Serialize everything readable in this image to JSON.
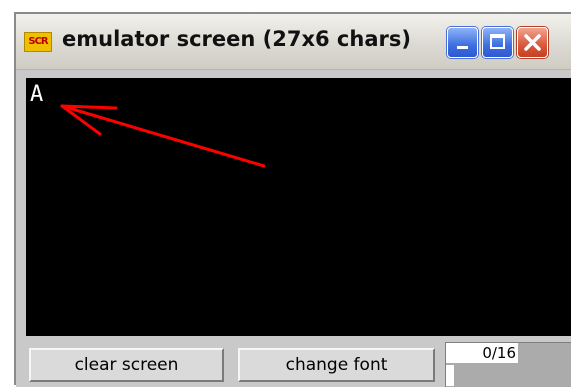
{
  "window": {
    "title": "emulator screen (27x6 chars)",
    "app_icon_text": "SCR",
    "icon": "scr-app-icon"
  },
  "title_buttons": {
    "minimize_icon": "minimize-icon",
    "maximize_icon": "maximize-icon",
    "close_icon": "close-icon"
  },
  "screen": {
    "text": "A",
    "background": "#000000",
    "foreground": "#ffffff",
    "annotation_color": "#ff0000"
  },
  "toolbar": {
    "clear_label": "clear screen",
    "font_label": "change font"
  },
  "progress": {
    "label": "0/16",
    "value": 0,
    "max": 16
  }
}
